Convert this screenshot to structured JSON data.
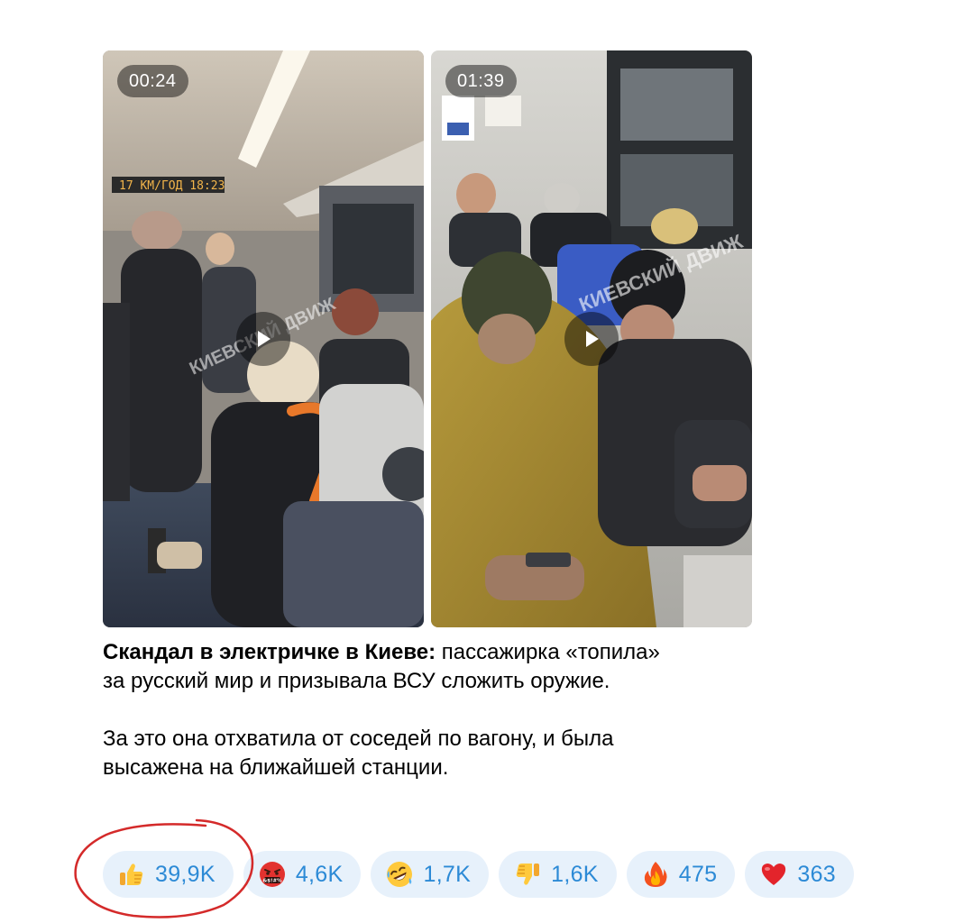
{
  "media": [
    {
      "duration": "00:24",
      "display_text": "17 КМ/ГОД  18:23",
      "watermark": "КИЕВСКИЙ ДВИЖ"
    },
    {
      "duration": "01:39",
      "watermark": "КИЕВСКИЙ ДВИЖ"
    }
  ],
  "caption": {
    "bold_lead": "Скандал в электричке в Киеве:",
    "line1_rest": " пассажирка «топила»",
    "line2": "за русский мир и призывала ВСУ сложить оружие.",
    "paragraph2_line1": "За это она отхватила от соседей по вагону, и была",
    "paragraph2_line2": "высажена на ближайшей станции."
  },
  "reactions": [
    {
      "emoji": "thumbs-up",
      "count": "39,9K"
    },
    {
      "emoji": "face-with-symbols-on-mouth",
      "count": "4,6K"
    },
    {
      "emoji": "rolling-on-the-floor-laughing",
      "count": "1,7K"
    },
    {
      "emoji": "thumbs-down",
      "count": "1,6K"
    },
    {
      "emoji": "fire",
      "count": "475"
    },
    {
      "emoji": "red-heart",
      "count": "363"
    }
  ],
  "colors": {
    "reaction_bg": "#e7f1fb",
    "reaction_count": "#2c8ad6",
    "annotation_circle": "#d42a2a"
  }
}
